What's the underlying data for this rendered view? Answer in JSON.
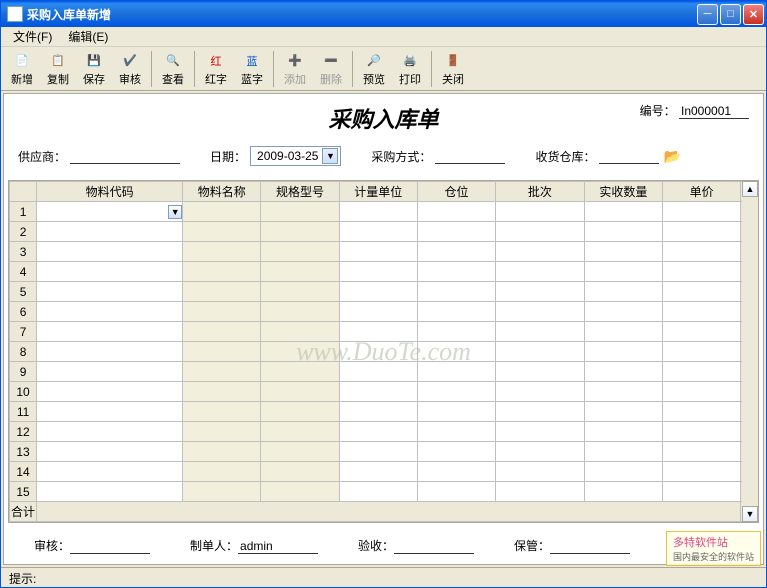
{
  "window": {
    "title": "采购入库单新增"
  },
  "menu": {
    "file": "文件(F)",
    "edit": "编辑(E)"
  },
  "toolbar": {
    "new": "新增",
    "copy": "复制",
    "save": "保存",
    "audit": "审核",
    "view": "查看",
    "red": "红字",
    "blue": "蓝字",
    "add": "添加",
    "del": "删除",
    "preview": "预览",
    "print": "打印",
    "close": "关闭"
  },
  "doc": {
    "title": "采购入库单",
    "no_label": "编号：",
    "no_value": "In000001",
    "supplier_label": "供应商：",
    "supplier_value": "",
    "date_label": "日期：",
    "date_value": "2009-03-25",
    "method_label": "采购方式：",
    "method_value": "",
    "warehouse_label": "收货仓库：",
    "warehouse_value": ""
  },
  "grid": {
    "headers": [
      "",
      "物料代码",
      "物料名称",
      "规格型号",
      "计量单位",
      "仓位",
      "批次",
      "实收数量",
      "单价"
    ],
    "rows": 15,
    "total_label": "合计"
  },
  "footer": {
    "audit_label": "审核：",
    "audit_value": "",
    "maker_label": "制单人：",
    "maker_value": "admin",
    "check_label": "验收：",
    "check_value": "",
    "keeper_label": "保管：",
    "keeper_value": ""
  },
  "status": {
    "hint": "提示:"
  },
  "watermark": {
    "center": "www.DuoTe.com",
    "badge": "多特软件站",
    "badge2": "国内最安全的软件站"
  }
}
